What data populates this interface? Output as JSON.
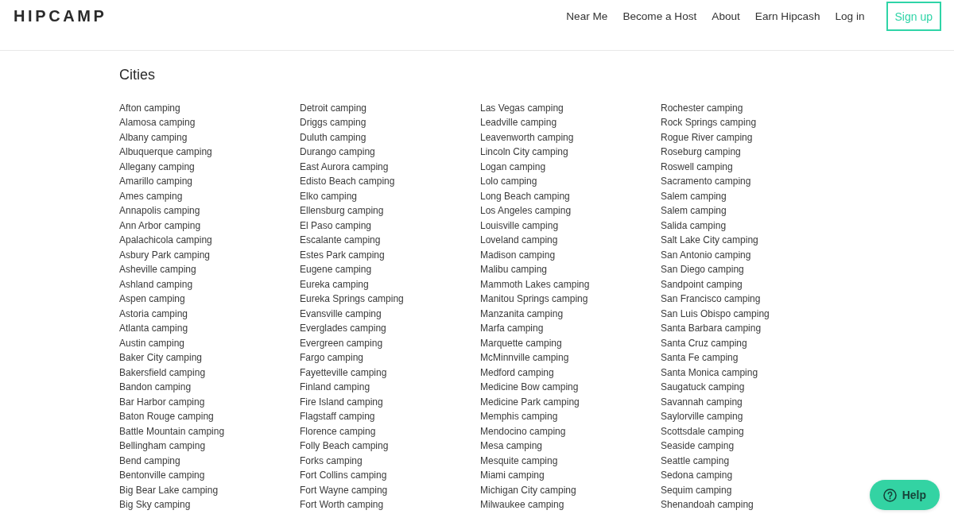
{
  "header": {
    "logo": "HIPCAMP",
    "nav": [
      {
        "label": "Near Me",
        "kind": "link"
      },
      {
        "label": "Become a Host",
        "kind": "link"
      },
      {
        "label": "About",
        "kind": "link"
      },
      {
        "label": "Earn Hipcash",
        "kind": "link"
      },
      {
        "label": "Log in",
        "kind": "link"
      },
      {
        "label": "Sign up",
        "kind": "button"
      }
    ]
  },
  "section": {
    "title": "Cities",
    "columns": [
      [
        "Afton camping",
        "Alamosa camping",
        "Albany camping",
        "Albuquerque camping",
        "Allegany camping",
        "Amarillo camping",
        "Ames camping",
        "Annapolis camping",
        "Ann Arbor camping",
        "Apalachicola camping",
        "Asbury Park camping",
        "Asheville camping",
        "Ashland camping",
        "Aspen camping",
        "Astoria camping",
        "Atlanta camping",
        "Austin camping",
        "Baker City camping",
        "Bakersfield camping",
        "Bandon camping",
        "Bar Harbor camping",
        "Baton Rouge camping",
        "Battle Mountain camping",
        "Bellingham camping",
        "Bend camping",
        "Bentonville camping",
        "Big Bear Lake camping",
        "Big Sky camping"
      ],
      [
        "Detroit camping",
        "Driggs camping",
        "Duluth camping",
        "Durango camping",
        "East Aurora camping",
        "Edisto Beach camping",
        "Elko camping",
        "Ellensburg camping",
        "El Paso camping",
        "Escalante camping",
        "Estes Park camping",
        "Eugene camping",
        "Eureka camping",
        "Eureka Springs camping",
        "Evansville camping",
        "Everglades camping",
        "Evergreen camping",
        "Fargo camping",
        "Fayetteville camping",
        "Finland camping",
        "Fire Island camping",
        "Flagstaff camping",
        "Florence camping",
        "Folly Beach camping",
        "Forks camping",
        "Fort Collins camping",
        "Fort Wayne camping",
        "Fort Worth camping"
      ],
      [
        "Las Vegas camping",
        "Leadville camping",
        "Leavenworth camping",
        "Lincoln City camping",
        "Logan camping",
        "Lolo camping",
        "Long Beach camping",
        "Los Angeles camping",
        "Louisville camping",
        "Loveland camping",
        "Madison camping",
        "Malibu camping",
        "Mammoth Lakes camping",
        "Manitou Springs camping",
        "Manzanita camping",
        "Marfa camping",
        "Marquette camping",
        "McMinnville camping",
        "Medford camping",
        "Medicine Bow camping",
        "Medicine Park camping",
        "Memphis camping",
        "Mendocino camping",
        "Mesa camping",
        "Mesquite camping",
        "Miami camping",
        "Michigan City camping",
        "Milwaukee camping"
      ],
      [
        "Rochester camping",
        "Rock Springs camping",
        "Rogue River camping",
        "Roseburg camping",
        "Roswell camping",
        "Sacramento camping",
        "Salem camping",
        "Salem camping",
        "Salida camping",
        "Salt Lake City camping",
        "San Antonio camping",
        "San Diego camping",
        "Sandpoint camping",
        "San Francisco camping",
        "San Luis Obispo camping",
        "Santa Barbara camping",
        "Santa Cruz camping",
        "Santa Fe camping",
        "Santa Monica camping",
        "Saugatuck camping",
        "Savannah camping",
        "Saylorville camping",
        "Scottsdale camping",
        "Seaside camping",
        "Seattle camping",
        "Sedona camping",
        "Sequim camping",
        "Shenandoah camping"
      ]
    ]
  },
  "help_button": {
    "label": "Help"
  }
}
